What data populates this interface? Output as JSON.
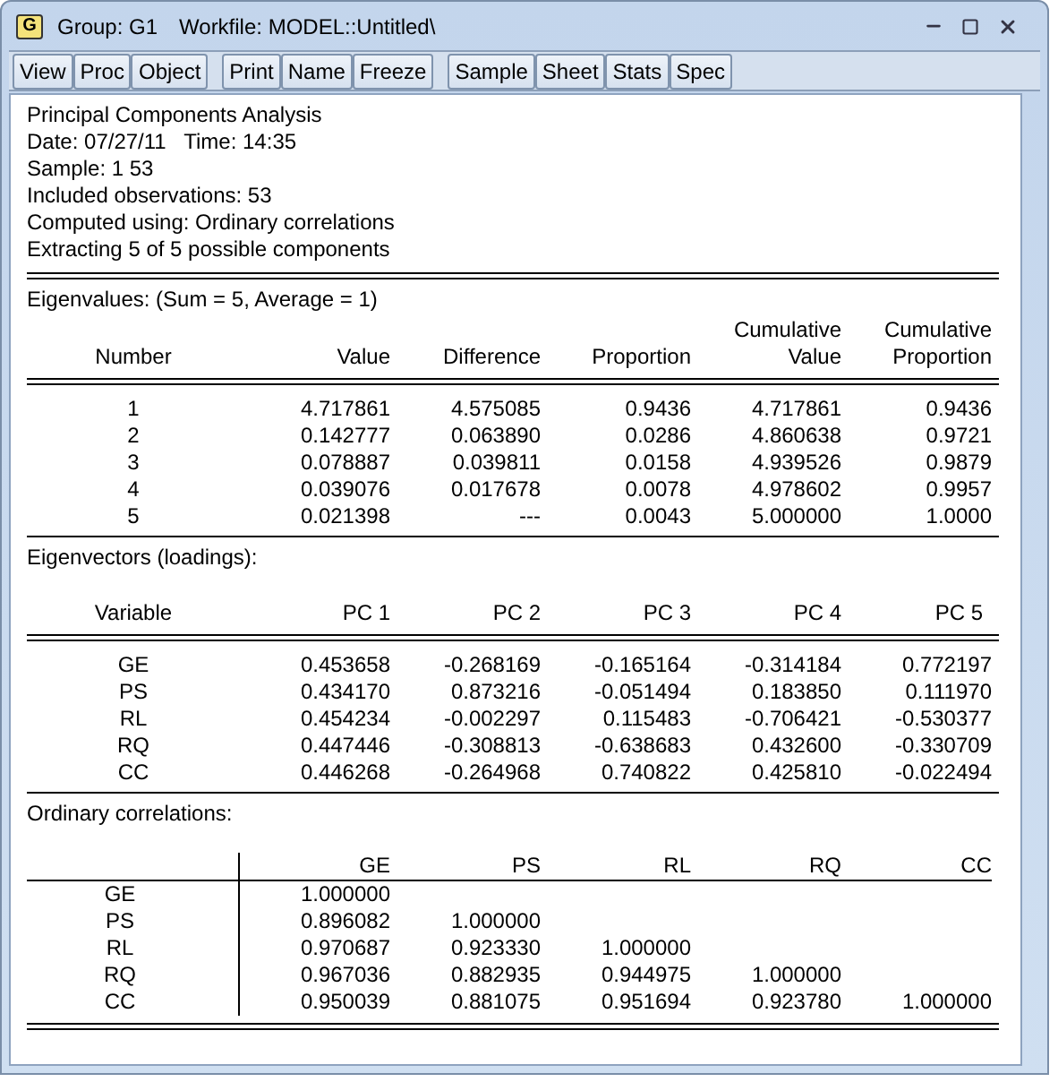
{
  "window": {
    "icon_letter": "G",
    "title": "Group: G1",
    "workfile": "Workfile: MODEL::Untitled\\"
  },
  "toolbar": [
    [
      "View",
      "Proc",
      "Object"
    ],
    [
      "Print",
      "Name",
      "Freeze"
    ],
    [
      "Sample",
      "Sheet",
      "Stats",
      "Spec"
    ]
  ],
  "header_lines": [
    "Principal Components Analysis",
    "Date: 07/27/11   Time: 14:35",
    "Sample: 1 53",
    "Included observations: 53",
    "Computed using: Ordinary correlations",
    "Extracting 5 of 5 possible components"
  ],
  "eigenvalues": {
    "caption": "Eigenvalues: (Sum = 5, Average = 1)",
    "header_rows": [
      [
        "",
        "",
        "",
        "",
        "Cumulative",
        "Cumulative"
      ],
      [
        "Number",
        "Value",
        "Difference",
        "Proportion",
        "Value",
        "Proportion"
      ]
    ],
    "rows": [
      [
        "1",
        "4.717861",
        "4.575085",
        "0.9436",
        "4.717861",
        "0.9436"
      ],
      [
        "2",
        "0.142777",
        "0.063890",
        "0.0286",
        "4.860638",
        "0.9721"
      ],
      [
        "3",
        "0.078887",
        "0.039811",
        "0.0158",
        "4.939526",
        "0.9879"
      ],
      [
        "4",
        "0.039076",
        "0.017678",
        "0.0078",
        "4.978602",
        "0.9957"
      ],
      [
        "5",
        "0.021398",
        "---",
        "0.0043",
        "5.000000",
        "1.0000"
      ]
    ]
  },
  "eigenvectors": {
    "caption": "Eigenvectors (loadings):",
    "header_rows": [
      [
        "Variable",
        "PC 1",
        "PC 2",
        "PC 3",
        "PC 4",
        "PC 5"
      ]
    ],
    "rows": [
      [
        "GE",
        "0.453658",
        "-0.268169",
        "-0.165164",
        "-0.314184",
        "0.772197"
      ],
      [
        "PS",
        "0.434170",
        "0.873216",
        "-0.051494",
        "0.183850",
        "0.111970"
      ],
      [
        "RL",
        "0.454234",
        "-0.002297",
        "0.115483",
        "-0.706421",
        "-0.530377"
      ],
      [
        "RQ",
        "0.447446",
        "-0.308813",
        "-0.638683",
        "0.432600",
        "-0.330709"
      ],
      [
        "CC",
        "0.446268",
        "-0.264968",
        "0.740822",
        "0.425810",
        "-0.022494"
      ]
    ]
  },
  "correlations": {
    "caption": "Ordinary correlations:",
    "columns": [
      "",
      "GE",
      "PS",
      "RL",
      "RQ",
      "CC"
    ],
    "rows": [
      [
        "GE",
        "1.000000"
      ],
      [
        "PS",
        "0.896082",
        "1.000000"
      ],
      [
        "RL",
        "0.970687",
        "0.923330",
        "1.000000"
      ],
      [
        "RQ",
        "0.967036",
        "0.882935",
        "0.944975",
        "1.000000"
      ],
      [
        "CC",
        "0.950039",
        "0.881075",
        "0.951694",
        "0.923780",
        "1.000000"
      ]
    ]
  }
}
